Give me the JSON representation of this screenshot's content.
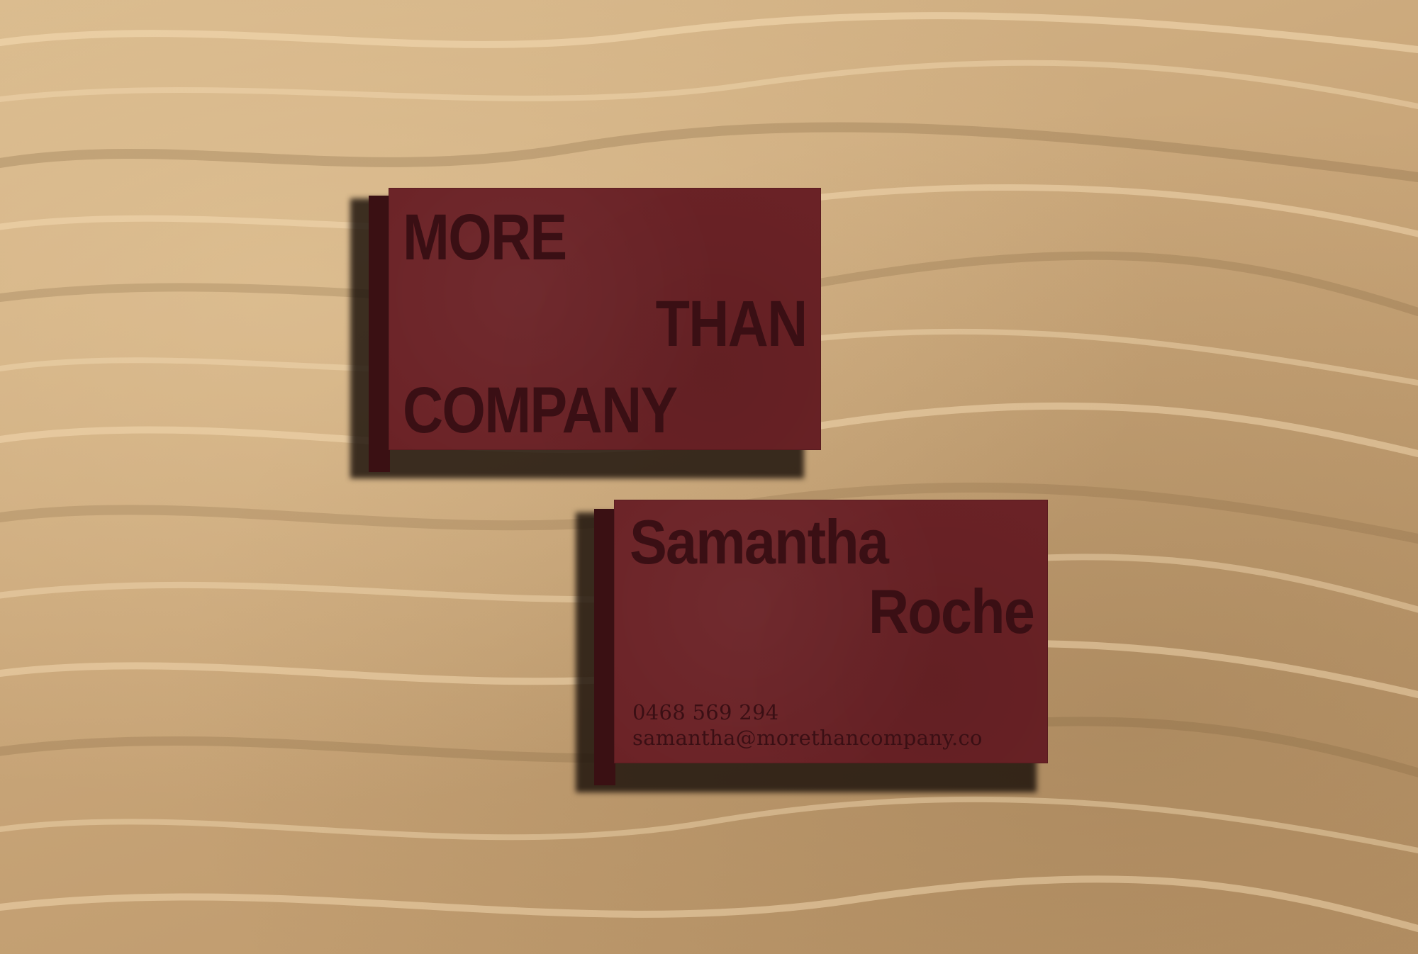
{
  "background": {
    "material": "sand",
    "color": "#c9a87c"
  },
  "cards": {
    "color": "#6b2226",
    "ink_color": "#3a0f14",
    "front": {
      "line1": "MORE",
      "line2": "THAN",
      "line3": "COMPANY"
    },
    "back": {
      "first_name": "Samantha",
      "last_name": "Roche",
      "phone": "0468 569 294",
      "email": "samantha@morethancompany.co"
    }
  }
}
